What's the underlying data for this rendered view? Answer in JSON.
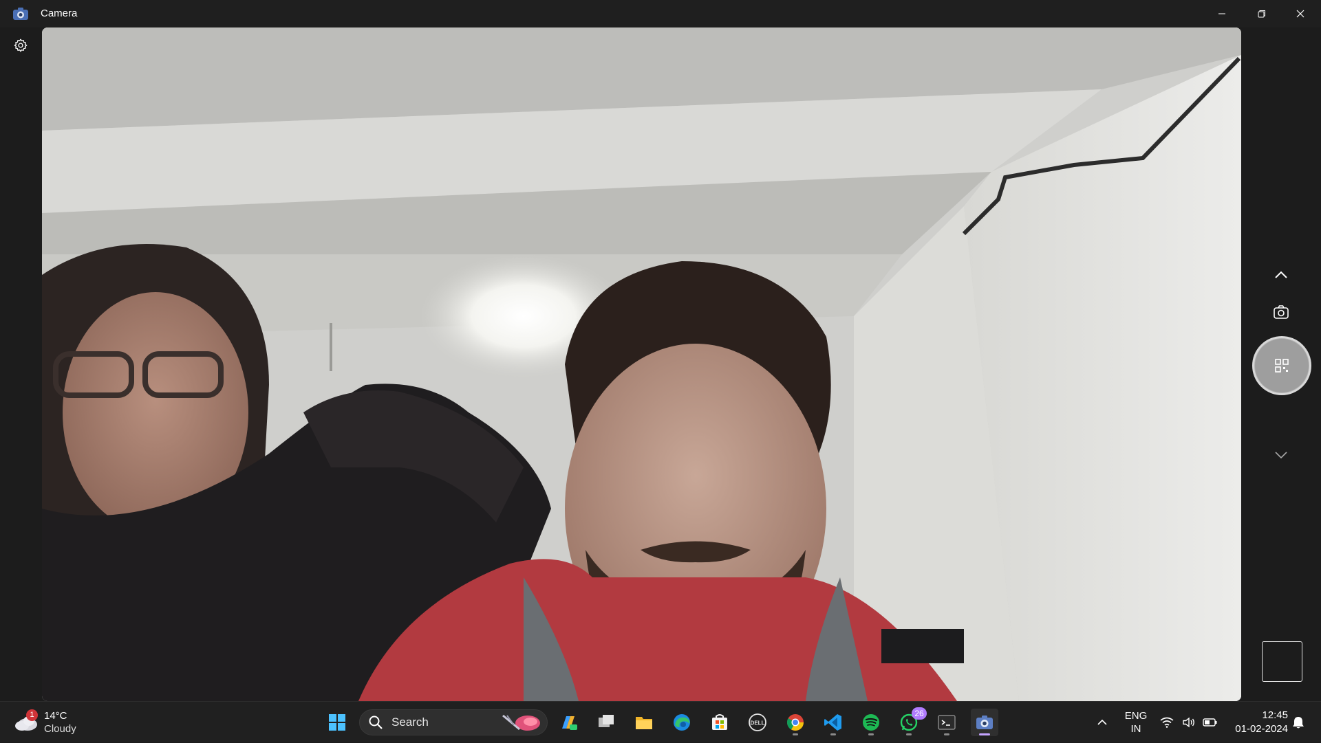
{
  "app": {
    "title": "Camera"
  },
  "window_controls": {
    "minimize": "minimize-icon",
    "maximize": "restore-icon",
    "close": "close-icon"
  },
  "camera": {
    "settings_icon": "gear-icon",
    "mode_up_icon": "chevron-up-icon",
    "photo_mode_icon": "camera-icon",
    "shutter_icon": "qr-scan-icon",
    "mode_down_icon": "chevron-down-icon"
  },
  "weather": {
    "temperature": "14°C",
    "condition": "Cloudy",
    "badge": "1"
  },
  "taskbar": {
    "search_placeholder": "Search",
    "apps": [
      {
        "name": "start"
      },
      {
        "name": "copilot"
      },
      {
        "name": "task-view"
      },
      {
        "name": "file-explorer"
      },
      {
        "name": "edge"
      },
      {
        "name": "microsoft-store"
      },
      {
        "name": "dell"
      },
      {
        "name": "chrome"
      },
      {
        "name": "vscode"
      },
      {
        "name": "spotify"
      },
      {
        "name": "whatsapp",
        "badge": "26"
      },
      {
        "name": "terminal"
      },
      {
        "name": "camera"
      }
    ]
  },
  "tray": {
    "lang_top": "ENG",
    "lang_bottom": "IN",
    "time": "12:45",
    "date": "01-02-2024"
  },
  "colors": {
    "accent": "#c4a3ff",
    "badge_red": "#d13438",
    "spotify": "#1db954",
    "whatsapp": "#25d366"
  }
}
